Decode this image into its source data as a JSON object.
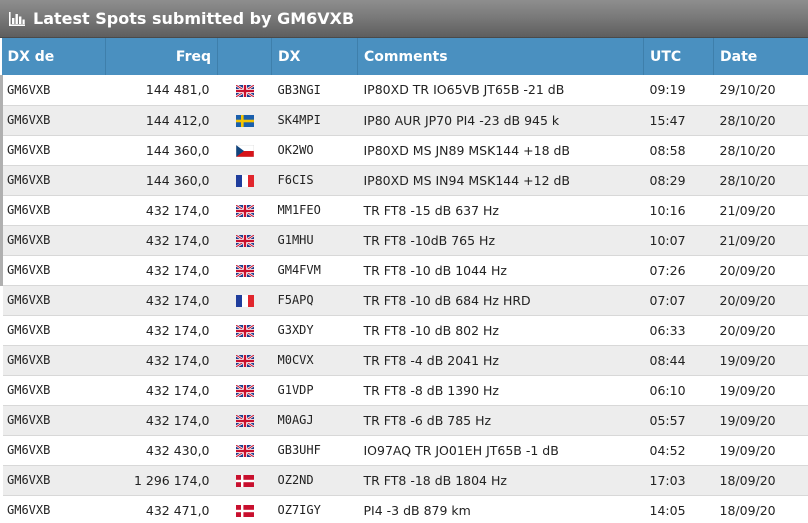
{
  "title": "Latest Spots submitted by GM6VXB",
  "columns": {
    "dx_de": "DX de",
    "freq": "Freq",
    "dx": "DX",
    "comments": "Comments",
    "utc": "UTC",
    "date": "Date"
  },
  "rows": [
    {
      "dx_de": "GM6VXB",
      "freq": "144 481,0",
      "flag": "uk",
      "dx": "GB3NGI",
      "comments": "IP80XD TR IO65VB JT65B -21 dB",
      "utc": "09:19",
      "date": "29/10/20"
    },
    {
      "dx_de": "GM6VXB",
      "freq": "144 412,0",
      "flag": "se",
      "dx": "SK4MPI",
      "comments": "IP80 AUR JP70 PI4 -23 dB 945 k",
      "utc": "15:47",
      "date": "28/10/20"
    },
    {
      "dx_de": "GM6VXB",
      "freq": "144 360,0",
      "flag": "cz",
      "dx": "OK2WO",
      "comments": "IP80XD MS JN89 MSK144 +18 dB",
      "utc": "08:58",
      "date": "28/10/20"
    },
    {
      "dx_de": "GM6VXB",
      "freq": "144 360,0",
      "flag": "fr",
      "dx": "F6CIS",
      "comments": "IP80XD MS IN94 MSK144 +12 dB",
      "utc": "08:29",
      "date": "28/10/20"
    },
    {
      "dx_de": "GM6VXB",
      "freq": "432 174,0",
      "flag": "uk",
      "dx": "MM1FEO",
      "comments": "TR FT8 -15 dB 637 Hz",
      "utc": "10:16",
      "date": "21/09/20"
    },
    {
      "dx_de": "GM6VXB",
      "freq": "432 174,0",
      "flag": "uk",
      "dx": "G1MHU",
      "comments": "TR FT8 -10dB 765 Hz",
      "utc": "10:07",
      "date": "21/09/20"
    },
    {
      "dx_de": "GM6VXB",
      "freq": "432 174,0",
      "flag": "uk",
      "dx": "GM4FVM",
      "comments": "TR FT8 -10 dB 1044 Hz",
      "utc": "07:26",
      "date": "20/09/20"
    },
    {
      "dx_de": "GM6VXB",
      "freq": "432 174,0",
      "flag": "fr",
      "dx": "F5APQ",
      "comments": "TR FT8 -10 dB 684 Hz HRD",
      "utc": "07:07",
      "date": "20/09/20"
    },
    {
      "dx_de": "GM6VXB",
      "freq": "432 174,0",
      "flag": "uk",
      "dx": "G3XDY",
      "comments": "TR FT8 -10 dB 802 Hz",
      "utc": "06:33",
      "date": "20/09/20"
    },
    {
      "dx_de": "GM6VXB",
      "freq": "432 174,0",
      "flag": "uk",
      "dx": "M0CVX",
      "comments": "TR FT8 -4 dB 2041 Hz",
      "utc": "08:44",
      "date": "19/09/20"
    },
    {
      "dx_de": "GM6VXB",
      "freq": "432 174,0",
      "flag": "uk",
      "dx": "G1VDP",
      "comments": "TR FT8 -8 dB 1390 Hz",
      "utc": "06:10",
      "date": "19/09/20"
    },
    {
      "dx_de": "GM6VXB",
      "freq": "432 174,0",
      "flag": "uk",
      "dx": "M0AGJ",
      "comments": "TR FT8 -6 dB 785 Hz",
      "utc": "05:57",
      "date": "19/09/20"
    },
    {
      "dx_de": "GM6VXB",
      "freq": "432 430,0",
      "flag": "uk",
      "dx": "GB3UHF",
      "comments": "IO97AQ TR JO01EH JT65B -1 dB",
      "utc": "04:52",
      "date": "19/09/20"
    },
    {
      "dx_de": "GM6VXB",
      "freq": "1 296 174,0",
      "flag": "dk",
      "dx": "OZ2ND",
      "comments": "TR FT8 -18 dB 1804 Hz",
      "utc": "17:03",
      "date": "18/09/20"
    },
    {
      "dx_de": "GM6VXB",
      "freq": "432 471,0",
      "flag": "dk",
      "dx": "OZ7IGY",
      "comments": "PI4 -3 dB 879 km",
      "utc": "14:05",
      "date": "18/09/20"
    }
  ],
  "colors": {
    "header_blue": "#4a90c0",
    "title_gray": "#777777",
    "row_alt": "#ededed"
  },
  "icons": {
    "title": "bar-chart-icon"
  }
}
